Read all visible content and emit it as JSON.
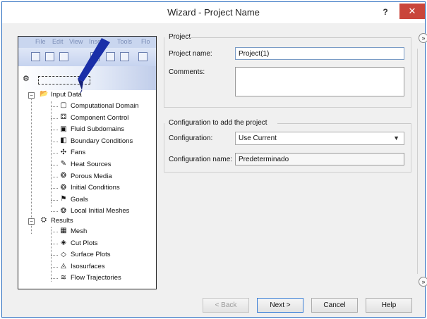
{
  "window": {
    "title": "Wizard - Project Name",
    "help_label": "?",
    "close_label": "✕"
  },
  "menubar": [
    "File",
    "Edit",
    "View",
    "Insert",
    "Tools",
    "Flo"
  ],
  "tree": {
    "input_data": {
      "label": "Input Data",
      "children": [
        {
          "label": "Computational Domain",
          "icon": "domain-icon"
        },
        {
          "label": "Component Control",
          "icon": "component-control-icon"
        },
        {
          "label": "Fluid Subdomains",
          "icon": "fluid-subdomain-icon"
        },
        {
          "label": "Boundary Conditions",
          "icon": "boundary-icon"
        },
        {
          "label": "Fans",
          "icon": "fan-icon"
        },
        {
          "label": "Heat Sources",
          "icon": "heat-source-icon"
        },
        {
          "label": "Porous Media",
          "icon": "porous-icon"
        },
        {
          "label": "Initial Conditions",
          "icon": "initial-conditions-icon"
        },
        {
          "label": "Goals",
          "icon": "goals-icon"
        },
        {
          "label": "Local Initial Meshes",
          "icon": "local-mesh-icon"
        }
      ]
    },
    "results": {
      "label": "Results",
      "children": [
        {
          "label": "Mesh",
          "icon": "mesh-icon"
        },
        {
          "label": "Cut Plots",
          "icon": "cut-plot-icon"
        },
        {
          "label": "Surface Plots",
          "icon": "surface-plot-icon"
        },
        {
          "label": "Isosurfaces",
          "icon": "isosurface-icon"
        },
        {
          "label": "Flow Trajectories",
          "icon": "trajectory-icon"
        }
      ]
    }
  },
  "project": {
    "group_title": "Project",
    "name_label": "Project name:",
    "name_value": "Project(1)",
    "comments_label": "Comments:",
    "comments_value": ""
  },
  "configuration": {
    "group_title": "Configuration to add the project",
    "config_label": "Configuration:",
    "config_value": "Use Current",
    "config_name_label": "Configuration name:",
    "config_name_value": "Predeterminado"
  },
  "side_buttons": {
    "top": "»",
    "bottom": "»"
  },
  "buttons": {
    "back": "< Back",
    "next": "Next >",
    "cancel": "Cancel",
    "help": "Help"
  }
}
